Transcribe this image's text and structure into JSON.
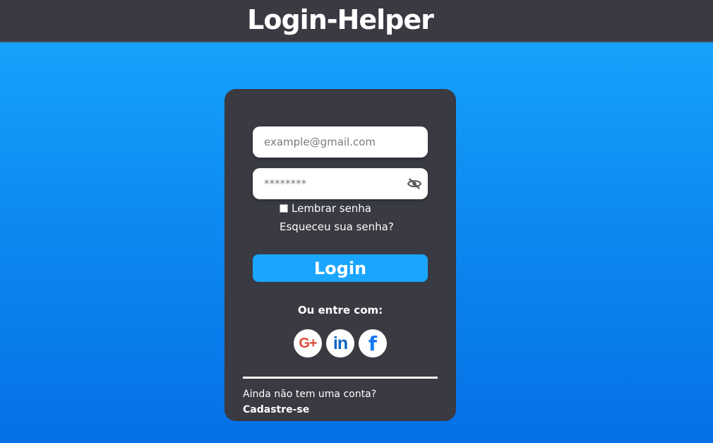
{
  "header": {
    "title": "Login-Helper"
  },
  "form": {
    "email_placeholder": "example@gmail.com",
    "password_placeholder": "********",
    "remember_label": "Lembrar senha",
    "forgot_label": "Esqueceu sua senha?",
    "login_label": "Login",
    "or_label": "Ou entre com:",
    "no_account_label": "Ainda não tem uma conta?",
    "signup_label": "Cadastre-se"
  },
  "social": [
    {
      "icon": "google-plus-icon",
      "glyph": "G+"
    },
    {
      "icon": "linkedin-icon",
      "glyph": "in"
    },
    {
      "icon": "facebook-icon",
      "glyph": "f"
    }
  ],
  "colors": {
    "header_bg": "#393a42",
    "card_bg": "#393a42",
    "accent": "#1aa6ff",
    "google": "#dd4b39",
    "linkedin": "#0a66c2",
    "facebook": "#1877f2"
  }
}
